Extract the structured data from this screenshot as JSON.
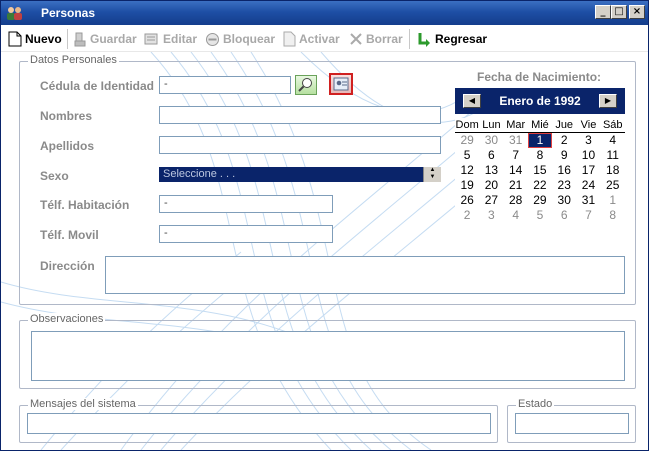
{
  "window": {
    "title": "Personas"
  },
  "toolbar": {
    "nuevo": "Nuevo",
    "guardar": "Guardar",
    "editar": "Editar",
    "bloquear": "Bloquear",
    "activar": "Activar",
    "borrar": "Borrar",
    "regresar": "Regresar"
  },
  "datos": {
    "legend": "Datos Personales",
    "cedula_label": "Cédula de Identidad",
    "cedula_value": "-",
    "nombres_label": "Nombres",
    "nombres_value": "",
    "apellidos_label": "Apellidos",
    "apellidos_value": "",
    "sexo_label": "Sexo",
    "sexo_value": "Seleccione . . .",
    "tel_hab_label": "Télf. Habitación",
    "tel_hab_value": "-",
    "tel_mov_label": "Télf. Movil",
    "tel_mov_value": "-",
    "direccion_label": "Dirección",
    "direccion_value": ""
  },
  "calendar": {
    "title": "Fecha de Nacimiento:",
    "month": "Enero de 1992",
    "prev_icon": "triangle-left",
    "next_icon": "triangle-right",
    "weekdays": [
      "Dom",
      "Lun",
      "Mar",
      "Mié",
      "Jue",
      "Vie",
      "Sáb"
    ],
    "weeks": [
      [
        "29",
        "30",
        "31",
        "1",
        "2",
        "3",
        "4"
      ],
      [
        "5",
        "6",
        "7",
        "8",
        "9",
        "10",
        "11"
      ],
      [
        "12",
        "13",
        "14",
        "15",
        "16",
        "17",
        "18"
      ],
      [
        "19",
        "20",
        "21",
        "22",
        "23",
        "24",
        "25"
      ],
      [
        "26",
        "27",
        "28",
        "29",
        "30",
        "31",
        "1"
      ],
      [
        "2",
        "3",
        "4",
        "5",
        "6",
        "7",
        "8"
      ]
    ],
    "selected": "1"
  },
  "observaciones": {
    "legend": "Observaciones",
    "value": ""
  },
  "mensajes": {
    "legend": "Mensajes del sistema",
    "value": ""
  },
  "estado": {
    "legend": "Estado",
    "value": ""
  },
  "colors": {
    "title_bar": "#1e4fa5",
    "calendar_header": "#0a246a",
    "selected_border": "#e04040",
    "disabled_text": "#a8a8a8",
    "label_gray": "#8a8a8a"
  }
}
